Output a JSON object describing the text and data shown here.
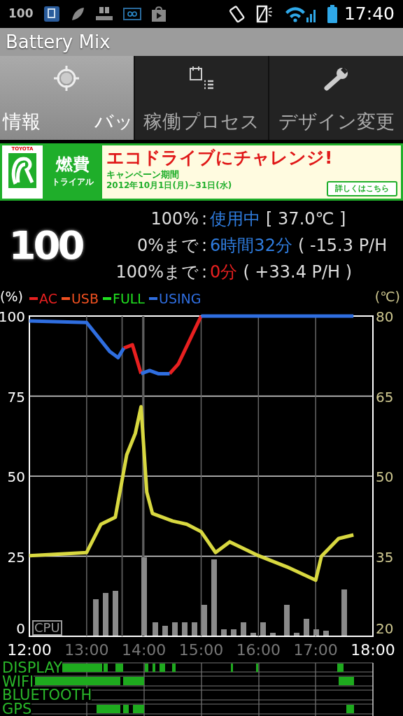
{
  "status_bar": {
    "battery_text": "100",
    "time": "17:40"
  },
  "window": {
    "title": "Battery Mix"
  },
  "tabs": [
    {
      "labels": [
        "情報",
        "バッ"
      ],
      "selected": true
    },
    {
      "labels": [
        "稼働プロセス"
      ],
      "selected": false
    },
    {
      "labels": [
        "デザイン変更"
      ],
      "selected": false
    }
  ],
  "ad": {
    "brand": "TOYOTA",
    "logo_title": "燃費",
    "logo_subtitle": "トライアル",
    "headline": "エコドライブにチャレンジ!",
    "period_label": "キャンペーン期間",
    "period": "2012年10月1日(月)~31日(水)",
    "button": "詳しくはこちら"
  },
  "summary": {
    "level": "100",
    "rows": [
      {
        "label": "100%",
        "separator": ":",
        "value": "使用中",
        "color": "#2f7de0",
        "detail": "[ 37.0℃ ]"
      },
      {
        "label": "0%まで",
        "separator": ":",
        "value": "6時間32分",
        "color": "#2f7de0",
        "detail": "( -15.3 P/H"
      },
      {
        "label": "100%まで",
        "separator": ":",
        "value": "0分",
        "color": "#e82020",
        "detail": "( +33.4 P/H )"
      }
    ]
  },
  "battery_chart": {
    "chart_data": {
      "type": "line",
      "ylabel": "(%)",
      "grid": true,
      "x": [
        12.0,
        13.0,
        13.4,
        13.55,
        13.65,
        13.8,
        13.95,
        14.1,
        14.25,
        14.45,
        14.6,
        15.0,
        15.5,
        16.0,
        16.5,
        17.0,
        17.66
      ],
      "series": [
        {
          "name": "AC",
          "color": "#e82020",
          "values": [
            null,
            null,
            null,
            null,
            90,
            91,
            82,
            null,
            null,
            82,
            85,
            100,
            null,
            null,
            null,
            null,
            null
          ]
        },
        {
          "name": "USB",
          "color": "#f05020",
          "values": [
            null,
            null,
            null,
            null,
            null,
            null,
            null,
            null,
            null,
            null,
            null,
            null,
            null,
            null,
            null,
            null,
            null
          ]
        },
        {
          "name": "FULL",
          "color": "#20e020",
          "values": [
            null,
            null,
            null,
            null,
            null,
            null,
            null,
            null,
            null,
            null,
            null,
            null,
            null,
            null,
            null,
            null,
            null
          ]
        },
        {
          "name": "USING",
          "color": "#2f6ee0",
          "values": [
            98.5,
            98,
            89,
            87,
            90,
            null,
            82,
            83,
            82,
            82,
            null,
            100,
            100,
            100,
            100,
            100,
            100
          ]
        }
      ],
      "xlim": [
        12,
        18
      ],
      "ylim": [
        0,
        100
      ],
      "yticks": [
        0,
        25,
        50,
        75,
        100
      ],
      "xticks": [
        {
          "value": 12,
          "label": "12:00"
        },
        {
          "value": 13,
          "label": "13:00"
        },
        {
          "value": 14,
          "label": "14:00"
        },
        {
          "value": 15,
          "label": "15:00"
        },
        {
          "value": 16,
          "label": "16:00"
        },
        {
          "value": 17,
          "label": "17:00"
        },
        {
          "value": 18,
          "label": "18:00"
        }
      ]
    },
    "cpu_label": "CPU"
  },
  "temperature_chart": {
    "chart_data": {
      "type": "line",
      "ylabel": "(℃)",
      "x": [
        12.0,
        13.0,
        13.25,
        13.5,
        13.7,
        13.85,
        13.95,
        14.05,
        14.15,
        14.5,
        14.75,
        15.0,
        15.25,
        15.5,
        16.0,
        16.5,
        17.0,
        17.1,
        17.4,
        17.66
      ],
      "series": [
        {
          "color": "#d8d840",
          "values": [
            35.1,
            35.7,
            41,
            42.3,
            54,
            58,
            63,
            47,
            43,
            41.6,
            41,
            39.6,
            35.7,
            37.7,
            35.1,
            33,
            30.5,
            35,
            38.3,
            39
          ]
        }
      ],
      "xlim": [
        12,
        18
      ],
      "ylim": [
        20,
        80
      ],
      "yticks": [
        20,
        35,
        50,
        65,
        80
      ]
    }
  },
  "activity": [
    {
      "label": "DISPLAY"
    },
    {
      "label": "WIFI"
    },
    {
      "label": "BLUETOOTH"
    },
    {
      "label": "GPS"
    }
  ]
}
